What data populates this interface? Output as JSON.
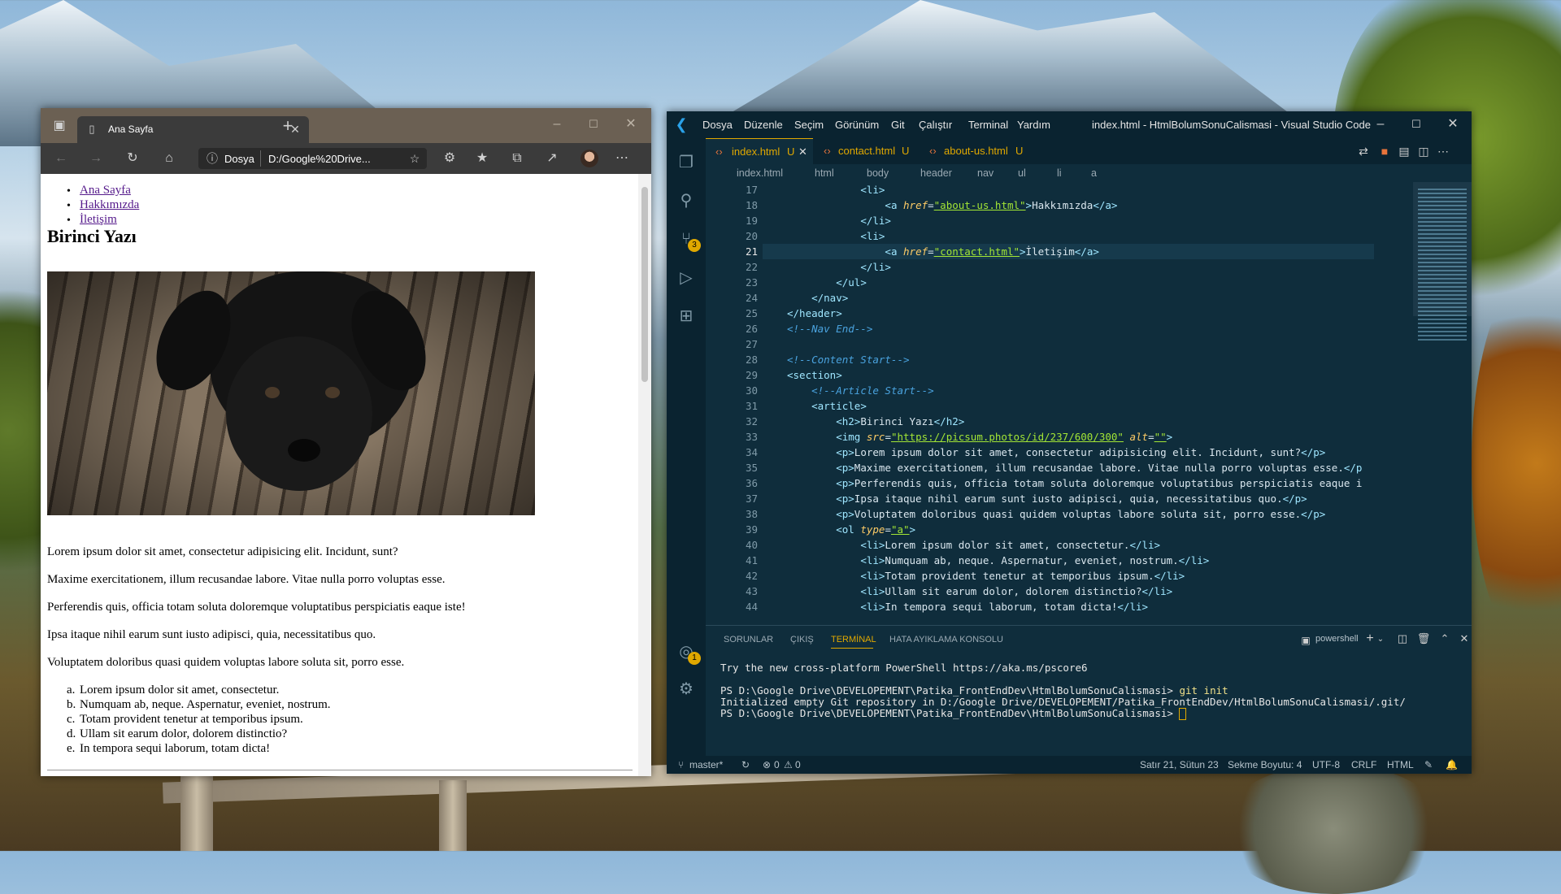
{
  "browser": {
    "tab_title": "Ana Sayfa",
    "addr_label": "Dosya",
    "addr_url": "D:/Google%20Drive...",
    "nav": [
      "Ana Sayfa",
      "Hakkımızda",
      "İletişim"
    ],
    "heading": "Birinci Yazı",
    "paragraphs": [
      "Lorem ipsum dolor sit amet, consectetur adipisicing elit. Incidunt, sunt?",
      "Maxime exercitationem, illum recusandae labore. Vitae nulla porro voluptas esse.",
      "Perferendis quis, officia totam soluta doloremque voluptatibus perspiciatis eaque iste!",
      "Ipsa itaque nihil earum sunt iusto adipisci, quia, necessitatibus quo.",
      "Voluptatem doloribus quasi quidem voluptas labore soluta sit, porro esse."
    ],
    "list_markers": [
      "a.",
      "b.",
      "c.",
      "d.",
      "e."
    ],
    "list": [
      "Lorem ipsum dolor sit amet, consectetur.",
      "Numquam ab, neque. Aspernatur, eveniet, nostrum.",
      "Totam provident tenetur at temporibus ipsum.",
      "Ullam sit earum dolor, dolorem distinctio?",
      "In tempora sequi laborum, totam dicta!"
    ]
  },
  "vscode": {
    "menu": [
      "Dosya",
      "Düzenle",
      "Seçim",
      "Görünüm",
      "Git",
      "Çalıştır",
      "Terminal",
      "Yardım"
    ],
    "window_title": "index.html - HtmlBolumSonuCalismasi - Visual Studio Code",
    "tabs": [
      {
        "label": "index.html",
        "badge": "U"
      },
      {
        "label": "contact.html",
        "badge": "U"
      },
      {
        "label": "about-us.html",
        "badge": "U"
      }
    ],
    "breadcrumb": [
      "index.html",
      "html",
      "body",
      "header",
      "nav",
      "ul",
      "li",
      "a"
    ],
    "scm_badge": "3",
    "account_badge": "1",
    "line_numbers": [
      "17",
      "18",
      "19",
      "20",
      "21",
      "22",
      "23",
      "24",
      "25",
      "26",
      "27",
      "28",
      "29",
      "30",
      "31",
      "32",
      "33",
      "34",
      "35",
      "36",
      "37",
      "38",
      "39",
      "40",
      "41",
      "42",
      "43",
      "44"
    ],
    "panel_tabs": [
      "SORUNLAR",
      "ÇIKIŞ",
      "TERMİNAL",
      "HATA AYIKLAMA KONSOLU"
    ],
    "shell": "powershell",
    "terminal": [
      "Try the new cross-platform PowerShell https://aka.ms/pscore6",
      "",
      "PS D:\\Google Drive\\DEVELOPEMENT\\Patika_FrontEndDev\\HtmlBolumSonuCalismasi> ",
      "Initialized empty Git repository in D:/Google Drive/DEVELOPEMENT/Patika_FrontEndDev/HtmlBolumSonuCalismasi/.git/",
      "PS D:\\Google Drive\\DEVELOPEMENT\\Patika_FrontEndDev\\HtmlBolumSonuCalismasi> "
    ],
    "terminal_cmd": "git init",
    "status": {
      "branch": "master*",
      "problems": "0",
      "warnings": "0",
      "position": "Satır 21, Sütun 23",
      "indent": "Sekme Boyutu: 4",
      "encoding": "UTF-8",
      "eol": "CRLF",
      "language": "HTML"
    }
  }
}
